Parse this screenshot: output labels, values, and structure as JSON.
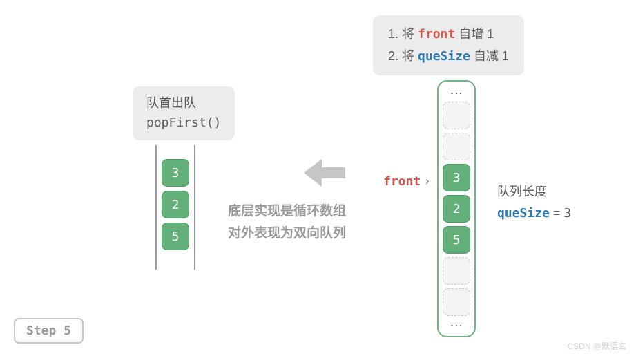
{
  "instruction": {
    "line1_pre": "1. 将 ",
    "line1_kw": "front",
    "line1_post": " 自增 1",
    "line2_pre": "2. 将 ",
    "line2_kw": "queSize",
    "line2_post": " 自减 1"
  },
  "labelBox": {
    "line1": "队首出队",
    "line2": "popFirst()"
  },
  "queue": {
    "v0": "3",
    "v1": "2",
    "v2": "5"
  },
  "arrow": {
    "name": "arrow-left"
  },
  "bottomText": {
    "line1": "底层实现是循环数组",
    "line2": "对外表现为双向队列"
  },
  "array": {
    "c0": "3",
    "c1": "2",
    "c2": "5"
  },
  "frontLabel": {
    "text": "front",
    "caret": "›"
  },
  "sizeInfo": {
    "label": "队列长度",
    "kw": "queSize",
    "eq": " = ",
    "val": "3"
  },
  "step": "Step 5",
  "watermark": "CSDN @默语玄"
}
